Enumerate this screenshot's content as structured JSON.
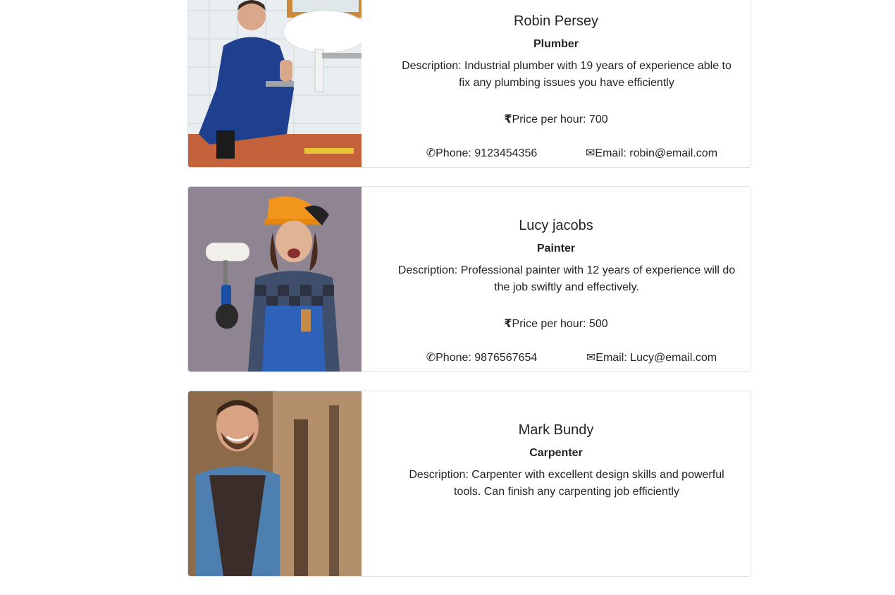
{
  "workers": [
    {
      "name": "Robin Persey",
      "role": "Plumber",
      "description": "Description: Industrial plumber with 19 years of experience able to fix any plumbing issues you have efficiently",
      "price": "Price per hour: 700",
      "phone": "Phone: 9123454356",
      "email": "Email: robin@email.com",
      "photo": "plumber-photo"
    },
    {
      "name": "Lucy jacobs",
      "role": "Painter",
      "description": "Description: Professional painter with 12 years of experience will do the job swiftly and effectively.",
      "price": "Price per hour: 500",
      "phone": "Phone: 9876567654",
      "email": "Email: Lucy@email.com",
      "photo": "painter-photo"
    },
    {
      "name": "Mark Bundy",
      "role": "Carpenter",
      "description": "Description: Carpenter with excellent design skills and powerful tools. Can finish any carpenting job efficiently",
      "price": "",
      "phone": "",
      "email": "",
      "photo": "carpenter-photo"
    }
  ],
  "icons": {
    "rupee": "₹",
    "phone": "✆",
    "email": "✉"
  },
  "colors": {
    "border": "#dee2e6",
    "text": "#212529"
  }
}
